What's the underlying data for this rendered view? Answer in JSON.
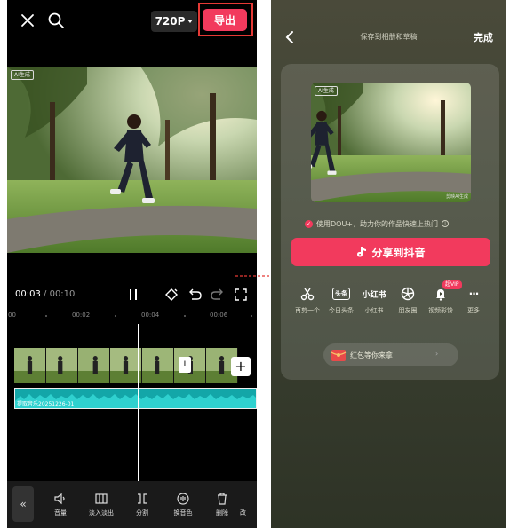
{
  "editor": {
    "resolution": "720P",
    "export_label": "导出",
    "ai_badge": "AI生成",
    "time_current": "00:03",
    "time_total": "00:10",
    "ruler_ticks": [
      "00",
      "00:02",
      "00:04",
      "00:06"
    ],
    "audio_clip_name": "提取音乐20251226-01",
    "tools": [
      {
        "label": "音量",
        "icon": "volume-icon"
      },
      {
        "label": "淡入淡出",
        "icon": "fade-icon"
      },
      {
        "label": "分割",
        "icon": "split-icon"
      },
      {
        "label": "换音色",
        "icon": "voice-change-icon"
      },
      {
        "label": "删除",
        "icon": "delete-icon"
      },
      {
        "label": "改",
        "icon": "more-icon"
      }
    ]
  },
  "share": {
    "title": "保存到相册和草稿",
    "done_label": "完成",
    "dou_text": "使用DOU+，助力你的作品快速上热门",
    "share_button": "分享到抖音",
    "thumb_watermark": "剪映AI生成",
    "vip_badge": "超VIP",
    "targets": [
      {
        "label": "再剪一个",
        "icon": "scissors-icon"
      },
      {
        "label": "今日头条",
        "icon": "toutiao-icon",
        "glyph": "头条"
      },
      {
        "label": "小红书",
        "icon": "xiaohongshu-icon",
        "glyph": "小红书"
      },
      {
        "label": "朋友圈",
        "icon": "moments-icon"
      },
      {
        "label": "视频彩铃",
        "icon": "ringtone-icon"
      },
      {
        "label": "更多",
        "icon": "more-dots-icon",
        "glyph": "···"
      }
    ],
    "promo_text": "红包等你来拿"
  },
  "colors": {
    "accent": "#f23a5d",
    "audio_track": "#13a6a8",
    "highlight_frame": "#e53935"
  }
}
